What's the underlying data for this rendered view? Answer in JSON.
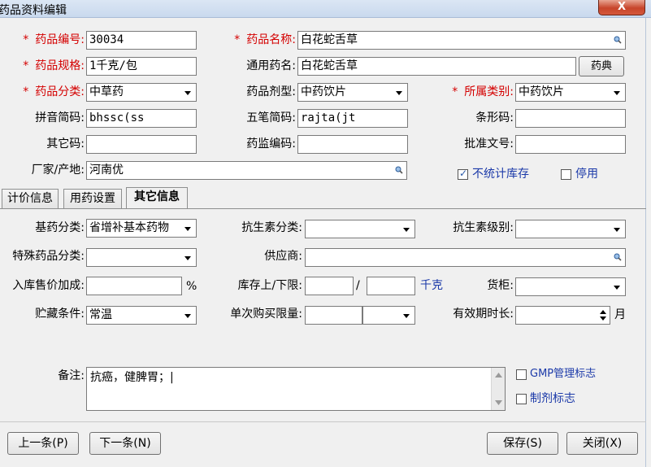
{
  "window": {
    "title": "药品资料编辑",
    "close": "X"
  },
  "fields": {
    "drug_code": {
      "label": "药品编号:",
      "value": "30034"
    },
    "drug_name": {
      "label": "药品名称:",
      "value": "白花蛇舌草"
    },
    "drug_spec": {
      "label": "药品规格:",
      "value": "1千克/包"
    },
    "common_name": {
      "label": "通用药名:",
      "value": "白花蛇舌草"
    },
    "pharmacopoeia_button": "药典",
    "drug_category": {
      "label": "药品分类:",
      "value": "中草药"
    },
    "dosage_form": {
      "label": "药品剂型:",
      "value": "中药饮片"
    },
    "belongs_category": {
      "label": "所属类别:",
      "value": "中药饮片"
    },
    "pinyin_code": {
      "label": "拼音简码:",
      "value": "bhssc(ss"
    },
    "wubi_code": {
      "label": "五笔简码:",
      "value": "rajta(jt"
    },
    "barcode": {
      "label": "条形码:",
      "value": ""
    },
    "other_code": {
      "label": "其它码:",
      "value": ""
    },
    "supervision_code": {
      "label": "药监编码:",
      "value": ""
    },
    "approval_number": {
      "label": "批准文号:",
      "value": ""
    },
    "manufacturer": {
      "label": "厂家/产地:",
      "value": "河南优"
    },
    "no_stock": {
      "label": "不统计库存",
      "checked": true
    },
    "disabled": {
      "label": "停用",
      "checked": false
    }
  },
  "tabs": [
    "计价信息",
    "用药设置",
    "其它信息"
  ],
  "other": {
    "essential_drug": {
      "label": "基药分类:",
      "value": "省增补基本药物"
    },
    "antibiotic_class": {
      "label": "抗生素分类:",
      "value": ""
    },
    "antibiotic_level": {
      "label": "抗生素级别:",
      "value": ""
    },
    "special_class": {
      "label": "特殊药品分类:",
      "value": ""
    },
    "supplier": {
      "label": "供应商:",
      "value": ""
    },
    "markup": {
      "label": "入库售价加成:",
      "value": "",
      "unit": "%"
    },
    "stock_limit": {
      "label": "库存上/下限:",
      "upper": "",
      "sep": "/",
      "lower": "",
      "unit": "千克"
    },
    "cabinet": {
      "label": "货柜:",
      "value": ""
    },
    "storage": {
      "label": "贮藏条件:",
      "value": "常温"
    },
    "purchase_limit": {
      "label": "单次购买限量:",
      "value": "",
      "unit": ""
    },
    "shelf_life": {
      "label": "有效期时长:",
      "value": "",
      "unit": "月"
    },
    "remarks": {
      "label": "备注:",
      "value": "抗癌，健脾胃；|"
    },
    "gmp": {
      "label": "GMP管理标志",
      "checked": false
    },
    "preparation": {
      "label": "制剂标志",
      "checked": false
    }
  },
  "buttons": {
    "prev": "上一条(P)",
    "next": "下一条(N)",
    "save": "保存(S)",
    "close": "关闭(X)"
  }
}
